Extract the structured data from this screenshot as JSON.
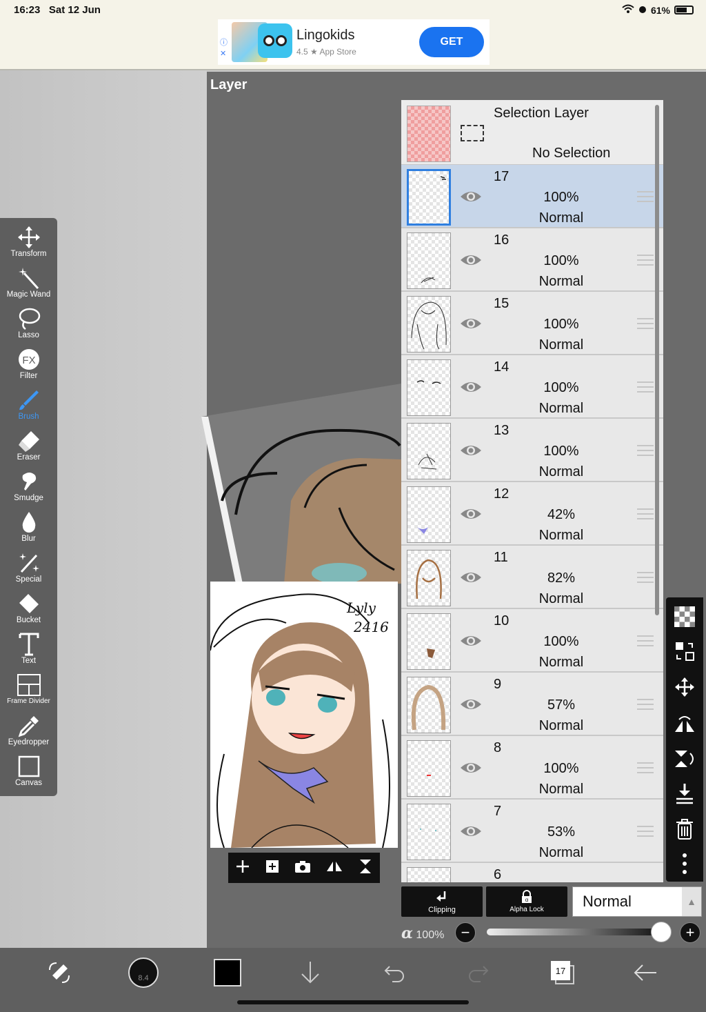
{
  "status": {
    "time": "16:23",
    "date": "Sat 12 Jun",
    "battery": "61%"
  },
  "ad": {
    "title": "Lingokids",
    "subtitle": "4.5 ★ App Store",
    "cta": "GET"
  },
  "panel": {
    "title": "Layer"
  },
  "tools": [
    {
      "label": "Transform",
      "icon": "transform-icon"
    },
    {
      "label": "Magic Wand",
      "icon": "magic-wand-icon"
    },
    {
      "label": "Lasso",
      "icon": "lasso-icon"
    },
    {
      "label": "Filter",
      "icon": "filter-icon"
    },
    {
      "label": "Brush",
      "icon": "brush-icon",
      "active": true
    },
    {
      "label": "Eraser",
      "icon": "eraser-icon"
    },
    {
      "label": "Smudge",
      "icon": "smudge-icon"
    },
    {
      "label": "Blur",
      "icon": "blur-icon"
    },
    {
      "label": "Special",
      "icon": "special-icon"
    },
    {
      "label": "Bucket",
      "icon": "bucket-icon"
    },
    {
      "label": "Text",
      "icon": "text-icon"
    },
    {
      "label": "Frame Divider",
      "icon": "frame-divider-icon"
    },
    {
      "label": "Eyedropper",
      "icon": "eyedropper-icon"
    },
    {
      "label": "Canvas",
      "icon": "canvas-icon"
    }
  ],
  "selection_layer": {
    "name": "Selection Layer",
    "status": "No Selection"
  },
  "layers": [
    {
      "number": "17",
      "opacity": "100%",
      "blend": "Normal",
      "selected": true
    },
    {
      "number": "16",
      "opacity": "100%",
      "blend": "Normal"
    },
    {
      "number": "15",
      "opacity": "100%",
      "blend": "Normal"
    },
    {
      "number": "14",
      "opacity": "100%",
      "blend": "Normal"
    },
    {
      "number": "13",
      "opacity": "100%",
      "blend": "Normal"
    },
    {
      "number": "12",
      "opacity": "42%",
      "blend": "Normal"
    },
    {
      "number": "11",
      "opacity": "82%",
      "blend": "Normal"
    },
    {
      "number": "10",
      "opacity": "100%",
      "blend": "Normal"
    },
    {
      "number": "9",
      "opacity": "57%",
      "blend": "Normal"
    },
    {
      "number": "8",
      "opacity": "100%",
      "blend": "Normal"
    },
    {
      "number": "7",
      "opacity": "53%",
      "blend": "Normal"
    },
    {
      "number": "6",
      "opacity": "",
      "blend": ""
    }
  ],
  "controls": {
    "clipping": "Clipping",
    "alpha_lock": "Alpha Lock",
    "blend_mode": "Normal",
    "alpha_symbol": "α",
    "alpha_value": "100%",
    "alpha_level": 1.0
  },
  "artwork": {
    "signature_line1": "Lyly",
    "signature_line2": "2416"
  },
  "bottom": {
    "brush_size": "8.4",
    "layer_count": "17"
  },
  "colors": {
    "accent": "#3d97f5",
    "selected_row": "#c7d6e9",
    "ad_button": "#1a73f0"
  }
}
